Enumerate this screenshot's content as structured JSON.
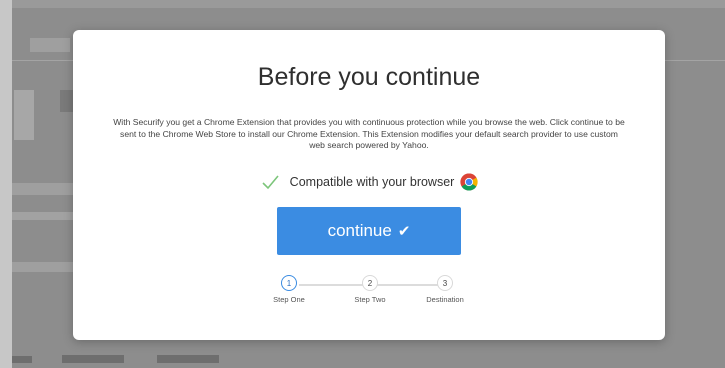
{
  "modal": {
    "title": "Before you continue",
    "description": "With Securify you get a Chrome Extension that provides you with continuous protection while you browse the web. Click continue to be sent to the Chrome Web Store to install our Chrome Extension. This Extension modifies your default search provider to use custom web search powered by Yahoo.",
    "compatibility": {
      "text": "Compatible with your browser",
      "check_icon": "check-icon",
      "browser_icon": "chrome-icon"
    },
    "continue_button": {
      "label": "continue",
      "icon": "checkmark-icon",
      "icon_glyph": "✔",
      "color": "#3b8ce2"
    },
    "steps": [
      {
        "number": "1",
        "label": "Step One",
        "active": true
      },
      {
        "number": "2",
        "label": "Step Two",
        "active": false
      },
      {
        "number": "3",
        "label": "Destination",
        "active": false
      }
    ]
  },
  "colors": {
    "overlay": "#8d8d8d",
    "accent": "#3b8ce2",
    "check_green": "#7cc57a"
  }
}
